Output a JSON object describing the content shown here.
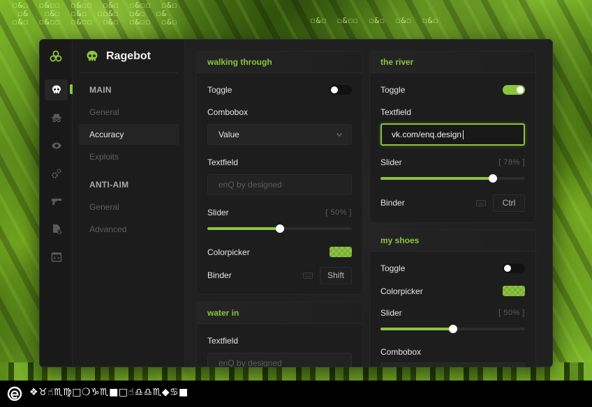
{
  "background": {
    "glyph_rows_left": "☐&☐  ☐&☐☐  ☐&☐☐  ☐&☐  ☐&☐☐  ☐&☐\n ☐&   ☐&☐  ☐&☐  ☐☐&☐  ☐&☐  ☐&\n☐&☐  ☐&☐☐  ☐&☐☐  ☐&☐  ☐&☐☐  ☐&☐",
    "glyph_rows_right": "☐&☐  ☐&☐☐  ☐&☐  ☐&☐  ☐&☐"
  },
  "app": {
    "accent": "#8bc53f",
    "rail_icons": [
      "biohazard-icon",
      "skull-icon",
      "spy-icon",
      "eye-icon",
      "gears-icon",
      "gun-icon",
      "file-gear-icon",
      "code-window-icon"
    ]
  },
  "sidebar": {
    "title": "Ragebot",
    "items": [
      {
        "label": "MAIN",
        "kind": "section"
      },
      {
        "label": "General",
        "kind": "item"
      },
      {
        "label": "Accuracy",
        "kind": "item",
        "active": true
      },
      {
        "label": "Exploits",
        "kind": "item"
      },
      {
        "label": "ANTI-AIM",
        "kind": "section"
      },
      {
        "label": "General",
        "kind": "item"
      },
      {
        "label": "Advanced",
        "kind": "item"
      }
    ]
  },
  "cards": {
    "walking": {
      "title": "walking through",
      "toggle_label": "Toggle",
      "toggle_on": false,
      "combobox_label": "Combobox",
      "combobox_value": "Value",
      "textfield_label": "Textfield",
      "textfield_placeholder": "enQ by designed",
      "slider_label": "Slider",
      "slider_value_text": "[ 50% ]",
      "slider_value": 0.5,
      "colorpicker_label": "Colorpicker",
      "colorpicker_color": "#8bc53f",
      "binder_label": "Binder",
      "binder_key": "Shift"
    },
    "water": {
      "title": "water in",
      "textfield_label": "Textfield",
      "textfield_placeholder": "enQ by designed"
    },
    "river": {
      "title": "the river",
      "toggle_label": "Toggle",
      "toggle_on": true,
      "textfield_label": "Textfield",
      "textfield_value": "vk.com/enq.design",
      "slider_label": "Slider",
      "slider_value_text": "[ 78% ]",
      "slider_value": 0.78,
      "binder_label": "Binder",
      "binder_key": "Ctrl"
    },
    "shoes": {
      "title": "my shoes",
      "toggle_label": "Toggle",
      "toggle_on": false,
      "colorpicker_label": "Colorpicker",
      "colorpicker_color": "#8bc53f",
      "slider_label": "Slider",
      "slider_value_text": "[ 50% ]",
      "slider_value": 0.5,
      "combobox_label": "Combobox"
    }
  },
  "bottombar": {
    "text": "❖♉︎☝︎♏︎♍︎□︎❍︎♑︎♏︎■︎□︎☝︎♎︎♎︎♏︎◆︎♋︎■︎"
  }
}
